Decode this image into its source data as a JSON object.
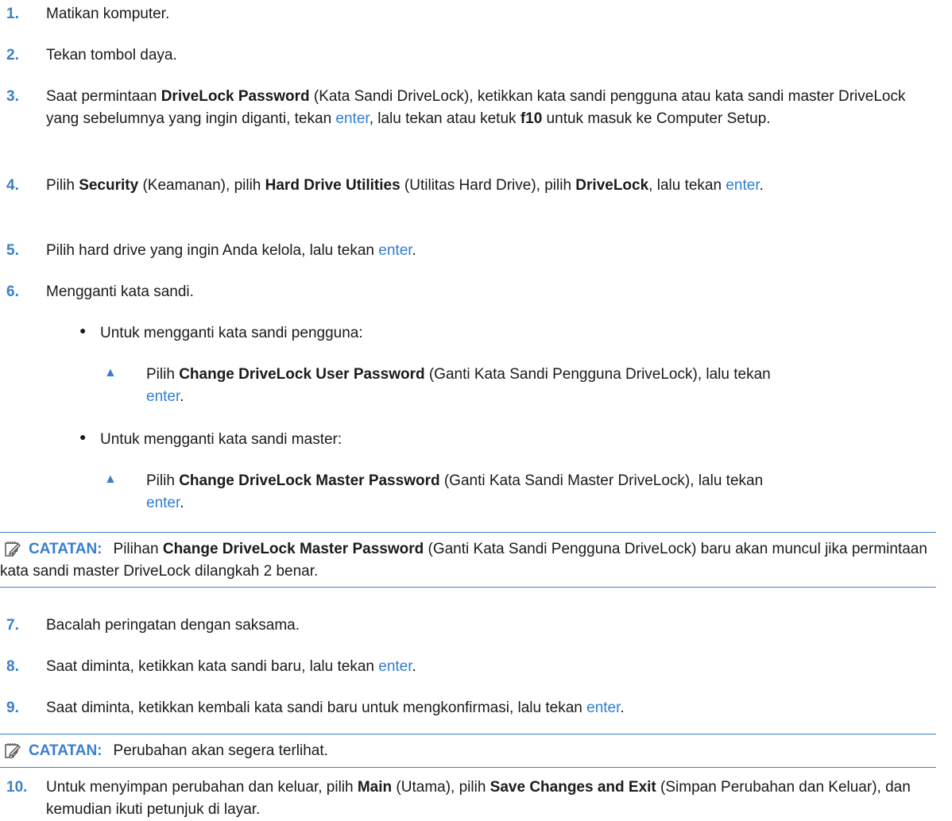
{
  "steps": [
    {
      "num": "1.",
      "text": "Matikan komputer."
    },
    {
      "num": "2.",
      "text": "Tekan tombol daya."
    },
    {
      "num": "3.",
      "pre": "Saat permintaan ",
      "bold1": "DriveLock Password",
      "mid1": " (Kata Sandi DriveLock), ketikkan kata sandi pengguna atau kata sandi master DriveLock yang sebelumnya yang ingin diganti, tekan ",
      "key": "enter",
      "mid2": ", lalu tekan atau ketuk ",
      "bold2": "f10",
      "post": " untuk masuk ke Computer Setup."
    },
    {
      "num": "4.",
      "pre": "Pilih ",
      "bold1": "Security",
      "mid1": " (Keamanan), pilih ",
      "bold2": "Hard Drive Utilities",
      "mid2": " (Utilitas Hard Drive), pilih ",
      "bold3": "DriveLock",
      "mid3": ", lalu tekan ",
      "key": "enter",
      "post": "."
    },
    {
      "num": "5.",
      "pre": "Pilih hard drive yang ingin Anda kelola, lalu tekan ",
      "key": "enter",
      "post": "."
    },
    {
      "num": "6.",
      "text": "Mengganti kata sandi."
    },
    {
      "num": "7.",
      "text": "Bacalah peringatan dengan saksama."
    },
    {
      "num": "8.",
      "pre": "Saat diminta, ketikkan kata sandi baru, lalu tekan ",
      "key": "enter",
      "post": "."
    },
    {
      "num": "9.",
      "pre": "Saat diminta, ketikkan kembali kata sandi baru untuk mengkonfirmasi, lalu tekan ",
      "key": "enter",
      "post": "."
    },
    {
      "num": "10.",
      "pre": "Untuk menyimpan perubahan dan keluar, pilih ",
      "bold1": "Main",
      "mid1": " (Utama), pilih ",
      "bold2": "Save Changes and Exit",
      "post": " (Simpan Perubahan dan Keluar), dan kemudian ikuti petunjuk di layar."
    }
  ],
  "sub_user": {
    "bullet": "●",
    "label": "Untuk mengganti kata sandi pengguna:",
    "marker": "▲",
    "pre": "Pilih ",
    "bold": "Change DriveLock User Password",
    "post": " (Ganti Kata Sandi Pengguna DriveLock), lalu tekan ",
    "key": "enter",
    "end": "."
  },
  "sub_master": {
    "bullet": "●",
    "label": "Untuk mengganti kata sandi master:",
    "marker": "▲",
    "pre": "Pilih ",
    "bold": "Change DriveLock Master Password",
    "post": " (Ganti Kata Sandi Master DriveLock), lalu tekan ",
    "key": "enter",
    "end": "."
  },
  "note1": {
    "label": "CATATAN:",
    "pre": "Pilihan ",
    "bold": "Change DriveLock Master Password",
    "post": " (Ganti Kata Sandi Pengguna DriveLock) baru akan muncul jika permintaan kata sandi master DriveLock dilangkah 2 benar."
  },
  "note2": {
    "label": "CATATAN:",
    "text": "Perubahan akan segera terlihat."
  },
  "icon": "note-icon",
  "colors": {
    "accent": "#3a7fcb",
    "link": "#2f7fd1",
    "text": "#1a1a1a"
  }
}
